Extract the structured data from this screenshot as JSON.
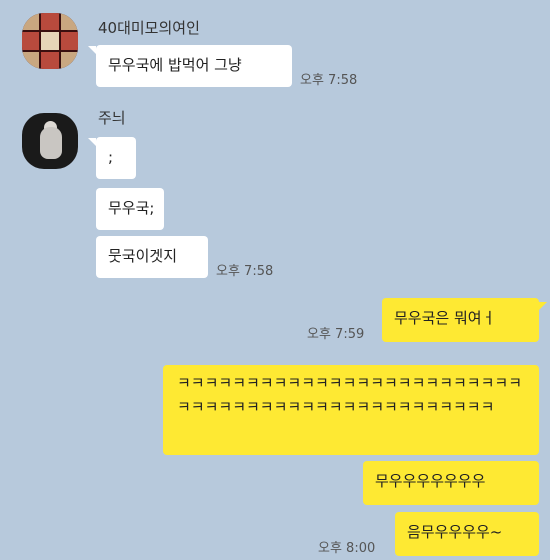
{
  "chat": {
    "sender1": {
      "name": "40대미모의여인",
      "avatar": "food-collage-avatar"
    },
    "sender2": {
      "name": "주늬",
      "avatar": "figure-avatar"
    },
    "messages": [
      {
        "text": "무우국에 밥먹어 그냥",
        "time": "오후 7:58"
      },
      {
        "text": ";"
      },
      {
        "text": "무우국;"
      },
      {
        "text": "뭇국이겟지",
        "time": "오후 7:58"
      },
      {
        "text": "무우국은 뭐여ㅓ",
        "time": "오후 7:59"
      },
      {
        "text": "ㅋㅋㅋㅋㅋㅋㅋㅋㅋㅋㅋㅋㅋㅋㅋㅋㅋㅋㅋㅋㅋㅋㅋㅋㅋㅋㅋㅋㅋㅋㅋㅋㅋㅋㅋㅋㅋㅋㅋㅋㅋㅋㅋㅋㅋㅋㅋㅋ"
      },
      {
        "text": "무우우우우우우우"
      },
      {
        "text": "음무우우우우~",
        "time": "오후 8:00"
      }
    ]
  },
  "colors": {
    "background": "#b7c9dc",
    "incoming": "#ffffff",
    "outgoing": "#fee933"
  }
}
